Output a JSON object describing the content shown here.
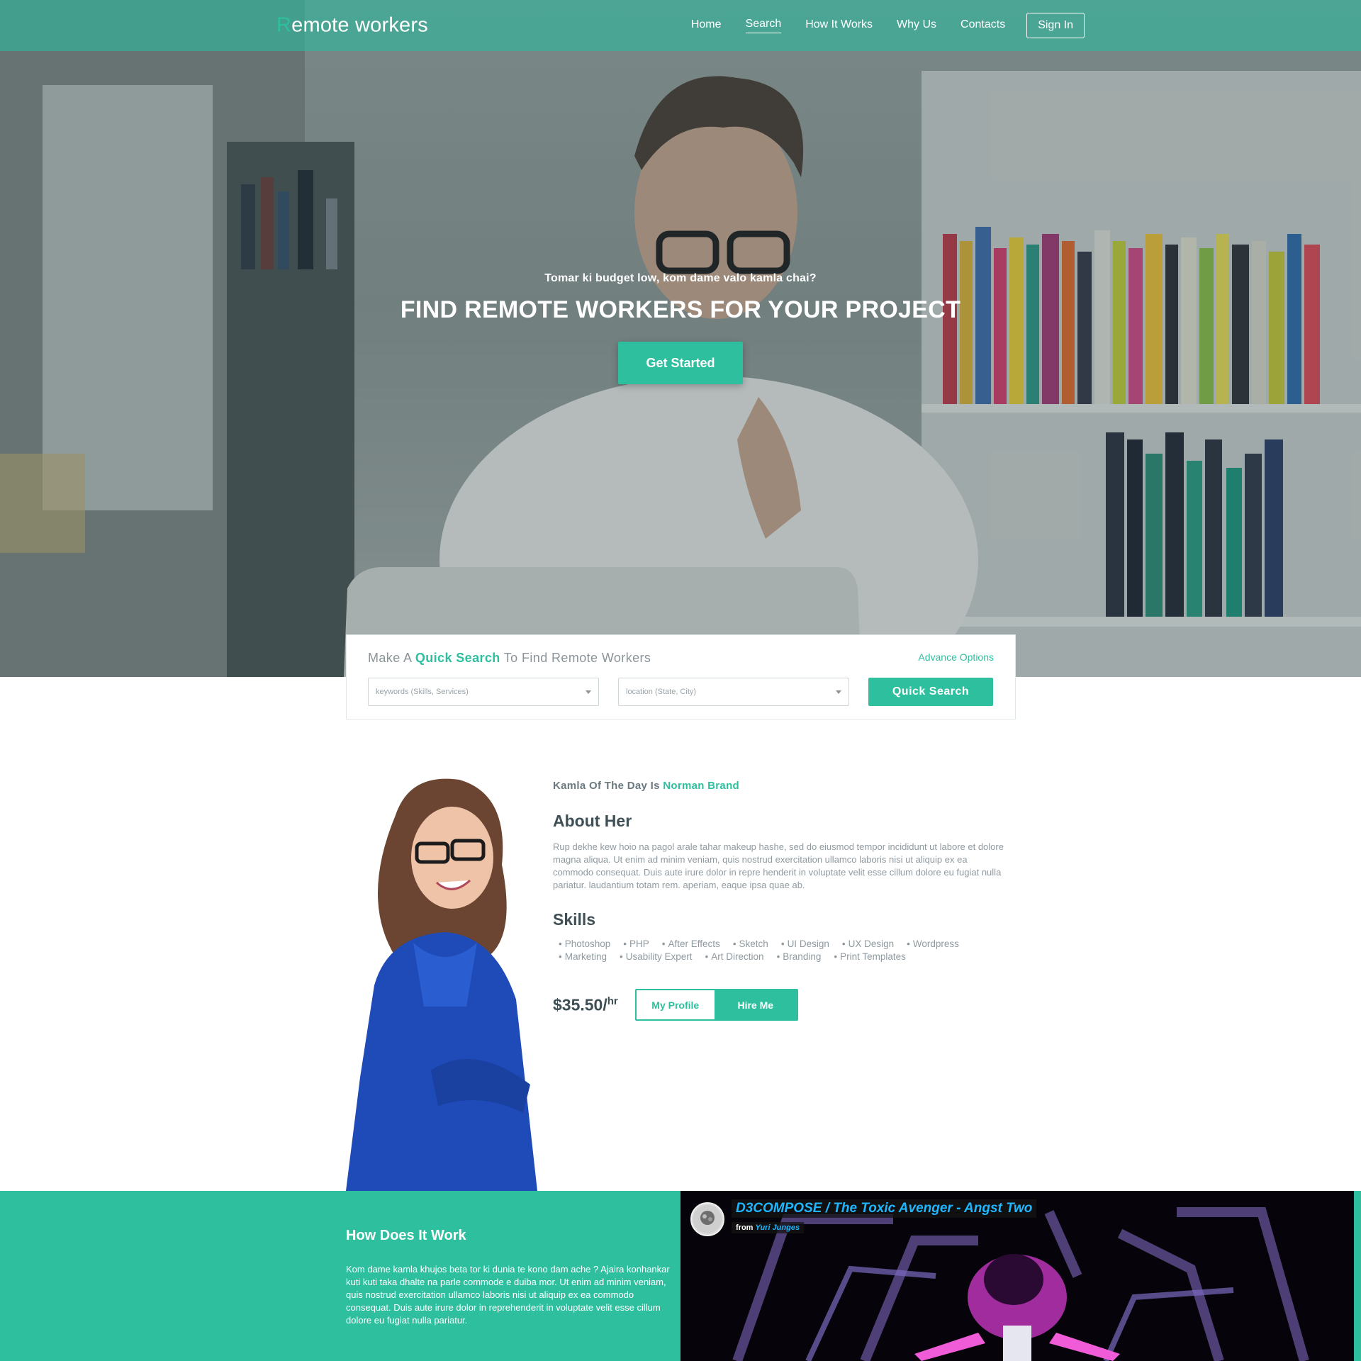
{
  "header": {
    "logo_first_letter": "R",
    "logo_rest": "emote workers",
    "nav": [
      {
        "label": "Home"
      },
      {
        "label": "Search"
      },
      {
        "label": "How It Works"
      },
      {
        "label": "Why Us"
      },
      {
        "label": "Contacts"
      }
    ],
    "signin_label": "Sign In"
  },
  "hero": {
    "subtitle": "Tomar ki budget low, kom dame valo kamla chai?",
    "title": "FIND REMOTE WORKERS FOR YOUR PROJECT",
    "cta_label": "Get Started"
  },
  "quick_search": {
    "title_prefix": "Make A",
    "title_highlight": "Quick Search",
    "title_suffix": "To Find Remote Workers",
    "advance_label": "Advance Options",
    "keywords_placeholder": "keywords (Skills, Services)",
    "location_placeholder": "location (State, City)",
    "button_label": "Quick Search"
  },
  "featured": {
    "intro_prefix": "Kamla Of The Day Is",
    "name": "Norman Brand",
    "about_heading": "About Her",
    "about_text": "Rup dekhe kew hoio na pagol arale tahar makeup hashe, sed do eiusmod tempor incididunt ut labore et dolore magna aliqua. Ut enim ad minim veniam, quis nostrud exercitation ullamco laboris nisi ut aliquip ex ea commodo consequat. Duis aute irure dolor in repre henderit in voluptate velit esse cillum dolore eu fugiat nulla pariatur. laudantium totam rem. aperiam, eaque ipsa quae ab.",
    "skills_heading": "Skills",
    "skills": [
      "Photoshop",
      "PHP",
      "After Effects",
      "Sketch",
      "UI Design",
      "UX Design",
      "Wordpress",
      "Marketing",
      "Usability Expert",
      "Art Direction",
      "Branding",
      "Print Templates"
    ],
    "rate": "$35.50/",
    "rate_unit": "hr",
    "profile_label": "My Profile",
    "hire_label": "Hire Me"
  },
  "how_it_works": {
    "title": "How Does It Work",
    "text": "Kom dame kamla khujos beta tor ki dunia te kono dam ache ? Ajaira konhankar kuti kuti taka dhalte na parle commode e duiba mor. Ut enim ad minim veniam, quis nostrud exercitation ullamco laboris nisi ut aliquip ex ea commodo consequat. Duis aute irure dolor in reprehenderit in voluptate velit esse cillum dolore eu fugiat nulla pariatur."
  },
  "video": {
    "title": "D3COMPOSE / The Toxic Avenger - Angst Two",
    "from_label": "from",
    "author": "Yuri Junges"
  },
  "colors": {
    "accent": "#2ebf9f",
    "heading": "#3e4f56",
    "body_text": "#8f9aa0",
    "video_link": "#1fb6ff"
  }
}
